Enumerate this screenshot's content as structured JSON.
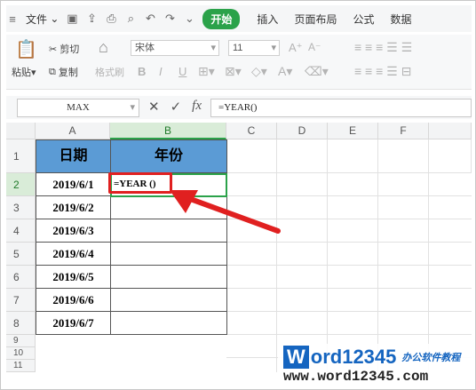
{
  "menu": {
    "file_label": "文件",
    "tabs": [
      "开始",
      "插入",
      "页面布局",
      "公式",
      "数据"
    ],
    "active_tab": "开始"
  },
  "ribbon": {
    "paste_label": "粘贴",
    "cut_label": "剪切",
    "copy_label": "复制",
    "format_painter_label": "格式刷",
    "font_name": "宋体",
    "font_size": "11",
    "bold": "B",
    "italic": "I",
    "underline": "U"
  },
  "formula_bar": {
    "name_box": "MAX",
    "fx_label": "fx",
    "formula": "=YEAR()"
  },
  "sheet": {
    "columns": [
      "A",
      "B",
      "C",
      "D",
      "E",
      "F"
    ],
    "selected_column": "B",
    "rows": [
      "1",
      "2",
      "3",
      "4",
      "5",
      "6",
      "7",
      "8",
      "9",
      "10",
      "11"
    ],
    "selected_row": "2",
    "headers": {
      "A1": "日期",
      "B1": "年份"
    },
    "dates": [
      "2019/6/1",
      "2019/6/2",
      "2019/6/3",
      "2019/6/4",
      "2019/6/5",
      "2019/6/6",
      "2019/6/7"
    ],
    "active_cell_text": "=YEAR ()"
  },
  "watermark": {
    "brand": "ord12345",
    "brand_initial": "W",
    "tagline": "办公软件教程",
    "url": "www.word12345.com"
  },
  "colors": {
    "accent_green": "#2ba24a",
    "header_fill": "#5b9bd5",
    "highlight_red": "#e02020"
  }
}
